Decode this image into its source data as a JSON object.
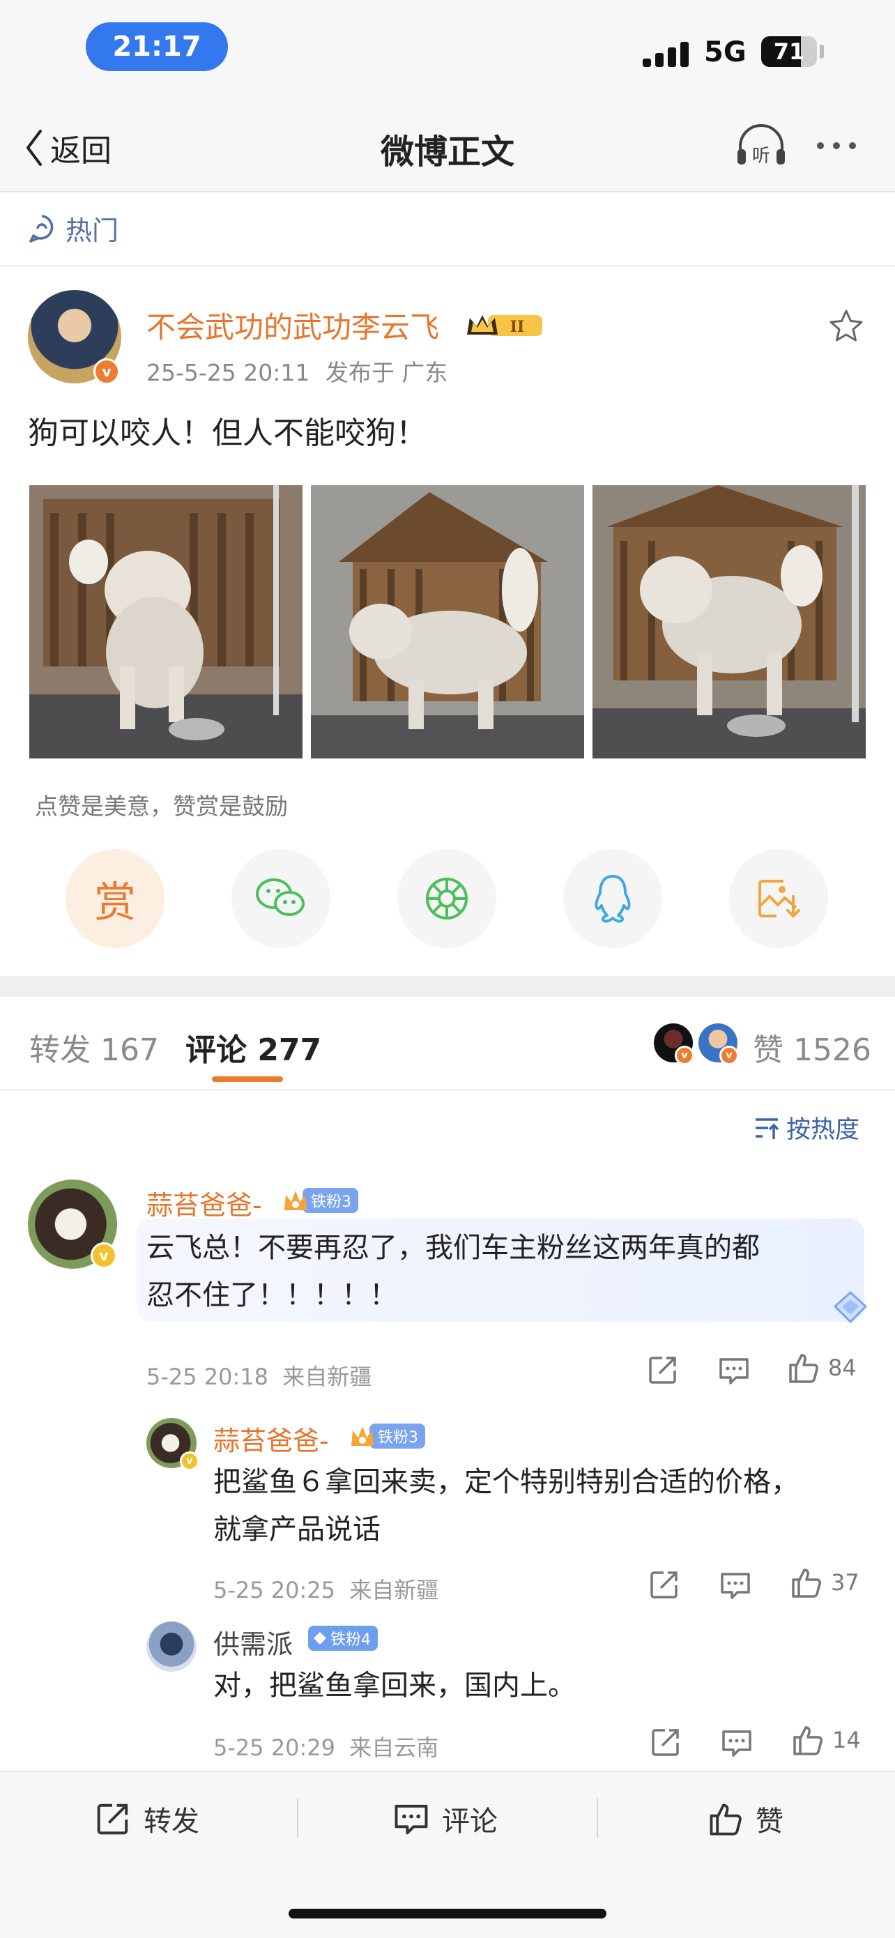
{
  "status_bar": {
    "time": "21:17",
    "network": "5G",
    "battery": "71",
    "battery_level": 0.71
  },
  "nav": {
    "back_label": "返回",
    "title": "微博正文",
    "listen_icon_text": "听"
  },
  "hot": {
    "label": "热门"
  },
  "post": {
    "author": "不会武功的武功李云飞",
    "level_badge": "II",
    "timestamp": "25-5-25 20:11",
    "location": "发布于 广东",
    "text": "狗可以咬人！但人不能咬狗！"
  },
  "reward": {
    "tip": "点赞是美意，赞赏是鼓励",
    "reward_label": "赏"
  },
  "tabs": {
    "repost": "转发 167",
    "comment": "评论 277",
    "like": "赞 1526"
  },
  "sort": {
    "label": "按热度"
  },
  "comments": [
    {
      "name": "蒜苔爸爸-",
      "badge": "铁粉3",
      "text_line1": "云飞总！不要再忍了，我们车主粉丝这两年真的都",
      "text_line2": "忍不住了！！！！！",
      "time": "5-25 20:18",
      "location": "来自新疆",
      "likes": "84"
    }
  ],
  "replies": [
    {
      "name": "蒜苔爸爸-",
      "badge": "铁粉3",
      "text_line1": "把鲨鱼６拿回来卖，定个特别特别合适的价格，",
      "text_line2": "就拿产品说话",
      "time": "5-25 20:25",
      "location": "来自新疆",
      "likes": "37"
    },
    {
      "name": "供需派",
      "badge": "铁粉4",
      "text_line1": "对，把鲨鱼拿回来，国内上。",
      "time": "5-25 20:29",
      "location": "来自云南",
      "likes": "14"
    }
  ],
  "bottom_bar": {
    "repost": "转发",
    "comment": "评论",
    "like": "赞"
  },
  "colors": {
    "accent_orange": "#e8752c",
    "link_blue": "#3b64a8",
    "verified_orange": "#ee7d32",
    "verified_gold": "#f2c12e"
  }
}
